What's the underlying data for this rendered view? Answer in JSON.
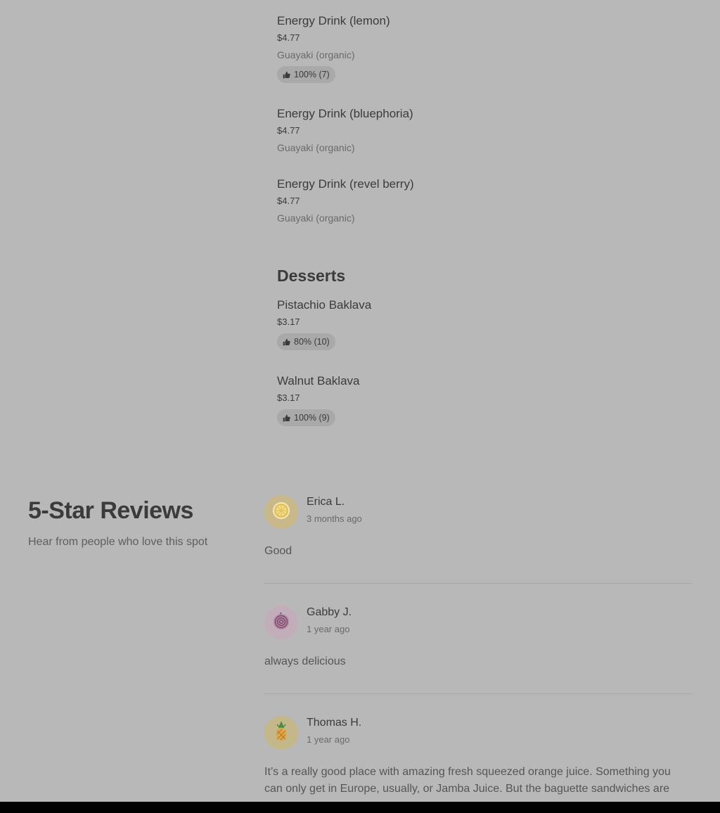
{
  "menu": {
    "items": [
      {
        "name": "Energy Drink (lemon)",
        "price": "$4.77",
        "description": "Guayaki (organic)",
        "rating": "100% (7)"
      },
      {
        "name": "Energy Drink (bluephoria)",
        "price": "$4.77",
        "description": "Guayaki (organic)"
      },
      {
        "name": "Energy Drink (revel berry)",
        "price": "$4.77",
        "description": "Guayaki (organic)"
      }
    ],
    "desserts": {
      "title": "Desserts",
      "items": [
        {
          "name": "Pistachio Baklava",
          "price": "$3.17",
          "rating": "80% (10)"
        },
        {
          "name": "Walnut Baklava",
          "price": "$3.17",
          "rating": "100% (9)"
        }
      ]
    }
  },
  "reviews": {
    "title": "5-Star Reviews",
    "subtitle": "Hear from people who love this spot",
    "list": [
      {
        "name": "Erica L.",
        "date": "3 months ago",
        "text": "Good",
        "avatar_icon": "lemon-icon",
        "avatar_color": "#c8b88a"
      },
      {
        "name": "Gabby J.",
        "date": "1 year ago",
        "text": "always delicious",
        "avatar_icon": "onion-icon",
        "avatar_color": "#c2adba"
      },
      {
        "name": "Thomas H.",
        "date": "1 year ago",
        "text": "It’s a really good place with amazing fresh squeezed orange juice. Something you can only get in Europe, usually, or Jamba Juice. But the baguette sandwiches are",
        "avatar_icon": "pineapple-icon",
        "avatar_color": "#c4b789"
      }
    ]
  },
  "colors": {
    "background": "#b8b8b8",
    "pill": "#a9a9a9",
    "divider": "#a6a6a6"
  }
}
